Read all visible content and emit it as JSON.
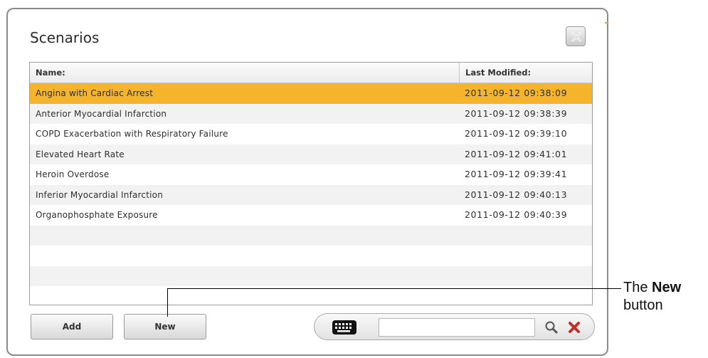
{
  "dialog": {
    "title": "Scenarios",
    "close_label": "close"
  },
  "table": {
    "columns": {
      "name": "Name:",
      "last_modified": "Last Modified:"
    },
    "rows": [
      {
        "name": "Angina with Cardiac Arrest",
        "last_modified": "2011-09-12 09:38:09",
        "selected": true
      },
      {
        "name": "Anterior Myocardial Infarction",
        "last_modified": "2011-09-12 09:38:39"
      },
      {
        "name": "COPD Exacerbation with Respiratory Failure",
        "last_modified": "2011-09-12 09:39:10"
      },
      {
        "name": "Elevated Heart Rate",
        "last_modified": "2011-09-12 09:41:01"
      },
      {
        "name": "Heroin Overdose",
        "last_modified": "2011-09-12 09:39:41"
      },
      {
        "name": "Inferior Myocardial Infarction",
        "last_modified": "2011-09-12 09:40:13"
      },
      {
        "name": "Organophosphate Exposure",
        "last_modified": "2011-09-12 09:40:39"
      }
    ],
    "selected_color": "#f6b42a"
  },
  "buttons": {
    "add": "Add",
    "new": "New"
  },
  "search": {
    "value": "",
    "icons": [
      "keyboard-icon",
      "search-icon",
      "clear-icon"
    ]
  },
  "callout": {
    "prefix": "The",
    "bold": "New",
    "suffix": "button"
  }
}
